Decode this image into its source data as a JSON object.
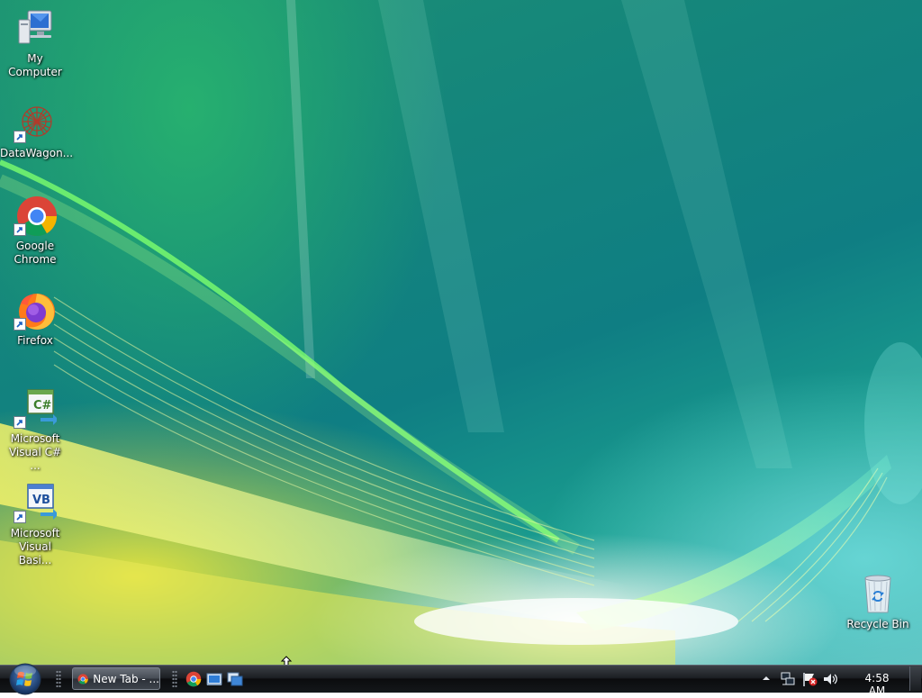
{
  "desktop": {
    "icons": [
      {
        "label": "My Computer",
        "icon": "computer-icon"
      },
      {
        "label": "DataWagon...",
        "icon": "datawagon-icon"
      },
      {
        "label": "Google Chrome",
        "icon": "chrome-icon"
      },
      {
        "label": "Firefox",
        "icon": "firefox-icon"
      },
      {
        "label": "Microsoft Visual C# ...",
        "icon": "visual-csharp-icon"
      },
      {
        "label": "Microsoft Visual Basi...",
        "icon": "visual-basic-icon"
      },
      {
        "label": "Recycle Bin",
        "icon": "recycle-bin-icon"
      }
    ]
  },
  "taskbar": {
    "start_icon": "windows-orb-icon",
    "task_buttons": [
      {
        "label": "New Tab - ...",
        "icon": "chrome-icon"
      }
    ],
    "quick_launch": [
      "chrome-icon",
      "show-desktop-icon",
      "switch-windows-icon"
    ],
    "tray": {
      "icons": [
        "show-hidden-icons-icon",
        "network-icon",
        "action-center-flag-icon",
        "volume-icon"
      ],
      "clock": "4:58 AM"
    }
  },
  "colors": {
    "taskbar_top": "#3b3f45",
    "taskbar_bottom": "#0b0c0e",
    "wallpaper_teal": "#0f7e83",
    "wallpaper_yellow": "#e6e23c",
    "wallpaper_green": "#2cb46e"
  }
}
